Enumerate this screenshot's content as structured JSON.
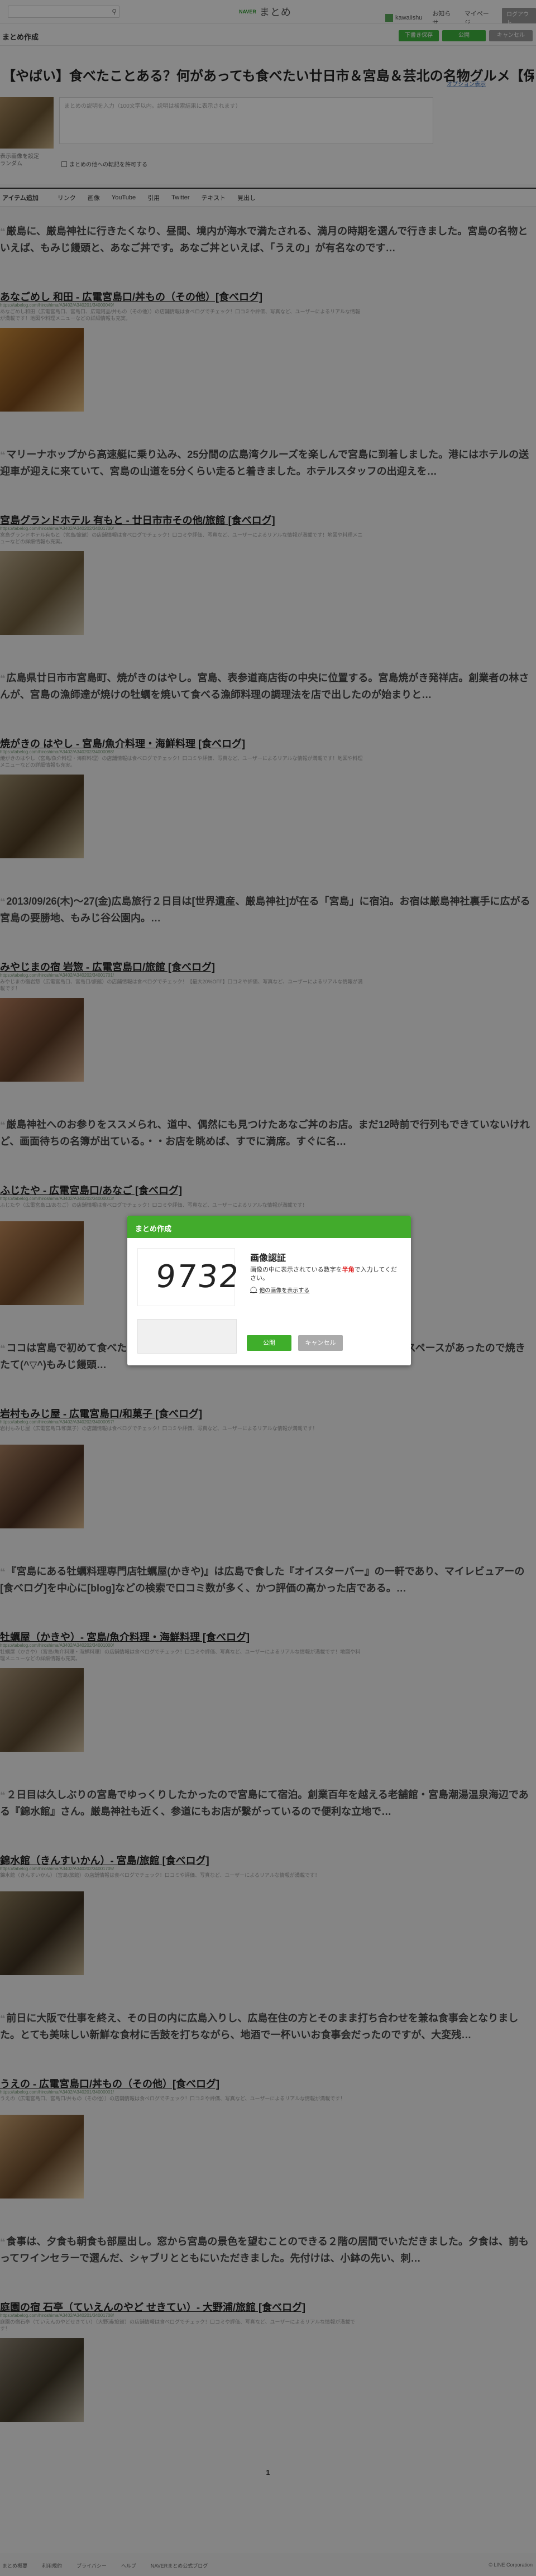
{
  "topbar": {
    "search_icon": "search-icon",
    "logo_small": "NAVER",
    "logo_main": "まとめ",
    "user_name": "kawaiishu",
    "notifications": "お知らせ",
    "my_page": "マイページ",
    "logout": "ログアウト"
  },
  "subbar": {
    "title": "まとめ作成",
    "save_draft": "下書き保存",
    "publish": "公開",
    "cancel": "キャンセル"
  },
  "header": {
    "title": "【やばい】食べたことある？何があっても食べたい廿日市＆宮島＆芸北の名物グルメ【保存版】",
    "options_link": "オプション表示",
    "description_placeholder": "まとめの説明を入力（100文字以内。説明は検索結果に表示されます）",
    "thumbnail_link": "表示画像を設定",
    "thumbnail_link2": "ランダム",
    "allow_comments": "まとめの他への転記を許可する"
  },
  "tabs": [
    "アイテム追加",
    "リンク",
    "画像",
    "YouTube",
    "引用",
    "Twitter",
    "テキスト",
    "見出し"
  ],
  "items": [
    {
      "quote": "厳島に、厳島神社に行きたくなり、昼間、境内が海水で満たされる、満月の時期を選んで行きました。宮島の名物といえば、もみじ饅頭と、あなご丼です。あなご丼といえば、「うえの」が有名なのです…",
      "title": "あなごめし 和田 - 広電宮島口/丼もの（その他）[食べログ]",
      "url": "https://tabelog.com/hiroshima/A3402/A340201/34000049/",
      "desc": "あなごめし和田（広電宮島口、宮島口、広電阿品/丼もの（その他））の店舗情報は食べログでチェック！口コミや評価、写真など、ユーザーによるリアルな情報が満載です！地図や料理メニューなどの詳細情報も充実。"
    },
    {
      "quote": "マリーナホップから高速艇に乗り込み、25分間の広島湾クルーズを楽しんで宮島に到着しました。港にはホテルの送迎車が迎えに来ていて、宮島の山道を5分くらい走ると着きました。ホテルスタッフの出迎えを…",
      "title": "宮島グランドホテル 有もと - 廿日市市その他/旅館 [食べログ]",
      "url": "https://tabelog.com/hiroshima/A3402/A340202/34001700/",
      "desc": "宮島グランドホテル有もと（宮島/旅館）の店舗情報は食べログでチェック！口コミや評価、写真など、ユーザーによるリアルな情報が満載です！地図や料理メニューなどの詳細情報も充実。"
    },
    {
      "quote": "広島県廿日市市宮島町、焼がきのはやし。宮島、表参道商店街の中央に位置する。宮島焼がき発祥店。創業者の林さんが、宮島の漁師達が焼けの牡蠣を焼いて食べる漁師料理の調理法を店で出したのが始まりと…",
      "title": "焼がきの はやし - 宮島/魚介料理・海鮮料理 [食べログ]",
      "url": "https://tabelog.com/hiroshima/A3402/A340202/34000088/",
      "desc": "焼がきのはやし（宮島/魚介料理・海鮮料理）の店舗情報は食べログでチェック！口コミや評価、写真など、ユーザーによるリアルな情報が満載です！地図や料理メニューなどの詳細情報も充実。"
    },
    {
      "quote": "2013/09/26(木)〜27(金)広島旅行２日目は[世界遺産、厳島神社]が在る「宮島」に宿泊。お宿は厳島神社裏手に広がる宮島の要勝地、もみじ谷公園内。…",
      "title": "みやじまの宿 岩惣 - 広電宮島口/旅館 [食べログ]",
      "url": "https://tabelog.com/hiroshima/A3402/A340202/34001701/",
      "desc": "みやじまの宿岩惣（広電宮島口、宮島口/旅館）の店舗情報は食べログでチェック！【最大20%OFF】口コミや評価、写真など、ユーザーによるリアルな情報が満載です！"
    },
    {
      "quote": "厳島神社へのお参りをススメられ、道中、偶然にも見つけたあなご丼のお店。まだ12時前で行列もできていないけれど、画面待ちの名簿が出ている。・・お店を眺めば、すでに満席。すぐに名…",
      "title": "ふじたや - 広電宮島口/あなご [食べログ]",
      "url": "https://tabelog.com/hiroshima/A3402/A340202/34000013/",
      "desc": "ふじたや（広電宮島口/あなご）の店舗情報は食べログでチェック！口コミや評価、写真など、ユーザーによるリアルな情報が満載です！"
    },
    {
      "quote": "ココは宮島で初めて食べたお饅頭やさんです。食べログ見て購入です。お店の前に座れるスペースがあったので焼きたて(^▽^)もみじ饅頭…",
      "title": "岩村もみじ屋 - 広電宮島口/和菓子 [食べログ]",
      "url": "https://tabelog.com/hiroshima/A3402/A340202/34000057/",
      "desc": "岩村もみじ屋（広電宮島口/和菓子）の店舗情報は食べログでチェック！口コミや評価、写真など、ユーザーによるリアルな情報が満載です！"
    },
    {
      "quote": "『宮島にある牡蠣料理専門店牡蠣屋(かきや)』は広島で食した『オイスターバー』の一軒であり、マイレビュアーの[食べログ]を中心に[blog]などの検索で口コミ数が多く、かつ評価の高かった店である。…",
      "title": "牡蠣屋（かきや）- 宮島/魚介料理・海鮮料理 [食べログ]",
      "url": "https://tabelog.com/hiroshima/A3402/A340202/34001000/",
      "desc": "牡蠣屋（かきや）（宮島/魚介料理・海鮮料理）の店舗情報は食べログでチェック！口コミや評価、写真など、ユーザーによるリアルな情報が満載です！地図や料理メニューなどの詳細情報も充実。"
    },
    {
      "quote": "２日目は久しぶりの宮島でゆっくりしたかったので宮島にて宿泊。創業百年を越える老舗館・宮島潮湯温泉海辺である『錦水館』さん。厳島神社も近く、参道にもお店が繋がっているので便利な立地で…",
      "title": "錦水館（きんすいかん）- 宮島/旅館 [食べログ]",
      "url": "https://tabelog.com/hiroshima/A3402/A340202/34001705/",
      "desc": "錦水館（きんすいかん）（宮島/旅館）の店舗情報は食べログでチェック！口コミや評価、写真など、ユーザーによるリアルな情報が満載です！"
    },
    {
      "quote": "前日に大阪で仕事を終え、その日の内に広島入りし、広島在住の方とそのまま打ち合わせを兼ね食事会となりました。とても美味しい新鮮な食材に舌鼓を打ちながら、地酒で一杯いいお食事会だったのですが、大変残…",
      "title": "うえの - 広電宮島口/丼もの（その他）[食べログ]",
      "url": "https://tabelog.com/hiroshima/A3402/A340201/34000001/",
      "desc": "うえの（広電宮島口、宮島口/丼もの（その他））の店舗情報は食べログでチェック！口コミや評価、写真など、ユーザーによるリアルな情報が満載です！"
    },
    {
      "quote": "食事は、夕食も朝食も部屋出し。窓から宮島の景色を望むことのできる２階の居間でいただきました。夕食は、前もってワインセラーで選んだ、シャブリとともにいただきました。先付けは、小鉢の先い、刺…",
      "title": "庭園の宿 石亭（ていえんのやど せきてい）- 大野浦/旅館 [食べログ]",
      "url": "https://tabelog.com/hiroshima/A3402/A340201/34001708/",
      "desc": "庭園の宿石亭（ていえんのやどせきてい）（大野浦/旅館）の店舗情報は食べログでチェック！口コミや評価、写真など、ユーザーによるリアルな情報が満載です！"
    }
  ],
  "pager": "1",
  "footer": {
    "links": [
      "まとめ概要",
      "利用規約",
      "プライバシー",
      "ヘルプ",
      "NAVERまとめ公式ブログ"
    ],
    "copyright": "© LINE Corporation"
  },
  "modal": {
    "header": "まとめ作成",
    "captcha_value": "9732",
    "title": "画像認証",
    "text_before": "画像の中に表示されている数字を",
    "text_red": "半角",
    "text_after": "で入力してください。",
    "refresh": "他の画像を表示する",
    "ok": "公開",
    "cancel": "キャンセル"
  },
  "colors": {
    "brand_green": "#42ab2c",
    "overlay": "rgba(0,0,0,0.45)"
  }
}
